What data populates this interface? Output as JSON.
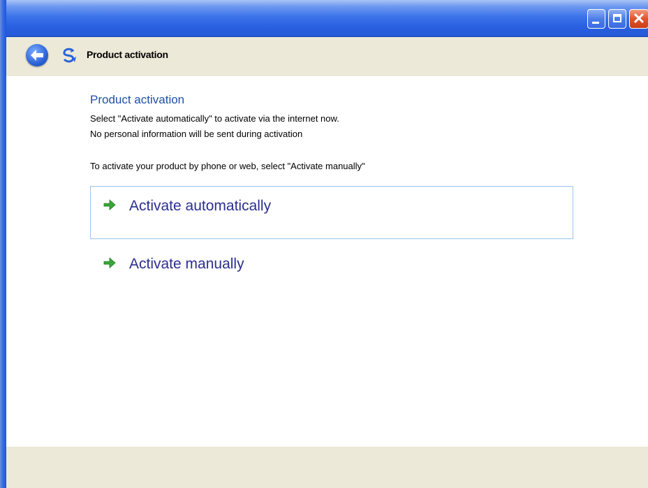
{
  "window": {
    "buttons": [
      {
        "name": "minimize-icon"
      },
      {
        "name": "maximize-icon"
      },
      {
        "name": "close-icon"
      }
    ]
  },
  "nav": {
    "title": "Product activation",
    "back_icon": "back-arrow-icon",
    "app_icon": "activation-icon"
  },
  "content": {
    "heading": "Product activation",
    "line1": "Select \"Activate automatically\" to activate via the internet now.",
    "line2": "No personal information will be sent during activation",
    "line3": "To activate your product by phone or web, select \"Activate manually\""
  },
  "options": [
    {
      "label": "Activate automatically",
      "icon": "green-arrow-icon"
    },
    {
      "label": "Activate manually",
      "icon": "green-arrow-icon"
    }
  ],
  "colors": {
    "title_bar": "#2a62e2",
    "heading": "#1f4fa8",
    "link": "#2b2f8f",
    "arrow": "#3aa63a",
    "panel": "#ece9d8",
    "close_button": "#e0532d"
  }
}
